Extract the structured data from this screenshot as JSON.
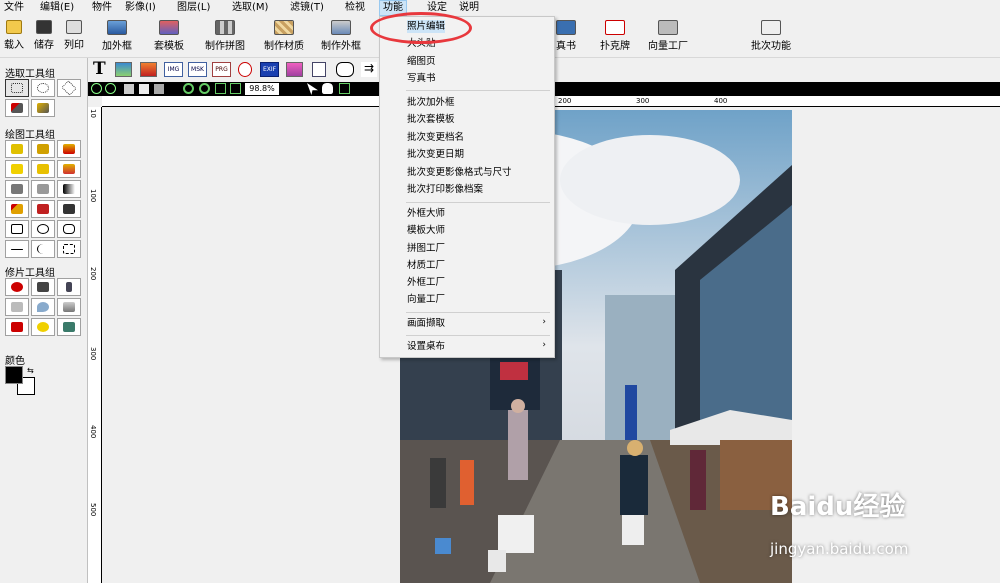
{
  "menubar": {
    "items": [
      "文件",
      "编辑(E)",
      "物件",
      "影像(I)",
      "图层(L)",
      "选取(M)",
      "滤镜(T)",
      "检视",
      "功能",
      "设定",
      "说明"
    ]
  },
  "toolbar": {
    "items": [
      "载入",
      "储存",
      "列印",
      "加外框",
      "套模板",
      "制作拼图",
      "制作材质",
      "制作外框",
      "真书",
      "扑克牌",
      "向量工厂",
      "批次功能"
    ]
  },
  "left_panel": {
    "select_group_label": "选取工具组",
    "draw_group_label": "绘图工具组",
    "retouch_group_label": "修片工具组",
    "color_label": "颜色"
  },
  "text_toolbar": {
    "text_tool": "T",
    "img_label": "IMG",
    "msk_label": "MSK",
    "prg_label": "PRG",
    "exif_label": "EXIF"
  },
  "zoom": {
    "level": "98.8%"
  },
  "ruler": {
    "h_labels": [
      "200",
      "300",
      "400"
    ],
    "v_labels": [
      "10",
      "100",
      "200",
      "300",
      "400",
      "500"
    ]
  },
  "dropdown": {
    "group1": [
      "照片编辑",
      "大头贴",
      "缩图页",
      "写真书"
    ],
    "group2": [
      "批次加外框",
      "批次套模板",
      "批次变更档名",
      "批次变更日期",
      "批次变更影像格式与尺寸",
      "批次打印影像档案"
    ],
    "group3": [
      "外框大师",
      "模板大师",
      "拼图工厂",
      "材质工厂",
      "外框工厂",
      "向量工厂"
    ],
    "group4": [
      "画面撷取",
      "设置桌布"
    ]
  },
  "watermark": {
    "brand": "Baidu经验",
    "url": "jingyan.baidu.com"
  }
}
